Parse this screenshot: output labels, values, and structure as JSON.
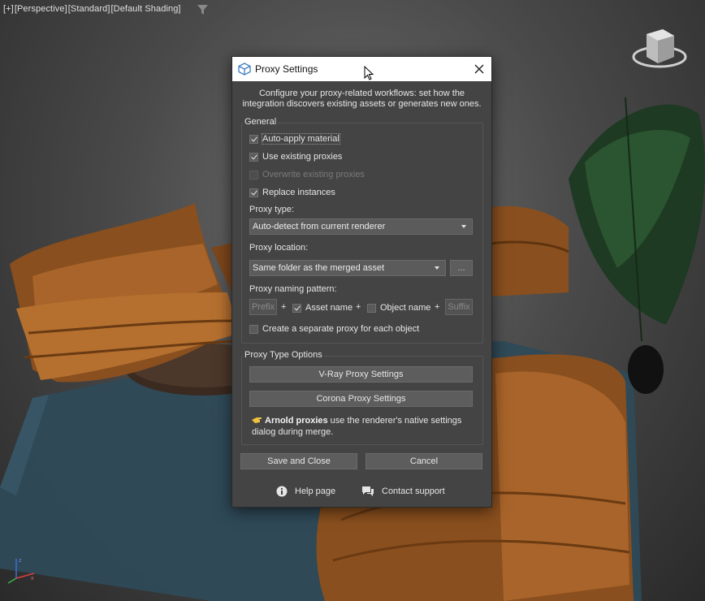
{
  "viewport": {
    "labels": [
      "[+]",
      "[Perspective]",
      "[Standard]",
      "[Default Shading]"
    ]
  },
  "dialog": {
    "title": "Proxy Settings",
    "description_line1": "Configure your proxy-related workflows: set how the",
    "description_line2": "integration discovers existing assets or generates new ones.",
    "general": {
      "title": "General",
      "auto_apply": {
        "label": "Auto-apply material",
        "checked": true
      },
      "use_existing": {
        "label": "Use existing proxies",
        "checked": true
      },
      "overwrite": {
        "label": "Overwrite existing proxies",
        "checked": false,
        "disabled": true
      },
      "replace": {
        "label": "Replace instances",
        "checked": true
      },
      "proxy_type_label": "Proxy type:",
      "proxy_type_value": "Auto-detect from current renderer",
      "proxy_location_label": "Proxy location:",
      "proxy_location_value": "Same folder as the merged asset",
      "browse_label": "...",
      "naming_label": "Proxy naming pattern:",
      "prefix_placeholder": "Prefix",
      "plus": "+",
      "asset_name": {
        "label": "Asset name",
        "checked": true
      },
      "object_name": {
        "label": "Object name",
        "checked": false
      },
      "suffix_placeholder": "Suffix",
      "separate_proxy": {
        "label": "Create a separate proxy for each object",
        "checked": false
      }
    },
    "type_options": {
      "title": "Proxy Type Options",
      "vray_button": "V-Ray Proxy Settings",
      "corona_button": "Corona Proxy Settings",
      "arnold_bold": "Arnold proxies",
      "arnold_text": " use the renderer's native settings dialog during merge."
    },
    "save_button": "Save and Close",
    "cancel_button": "Cancel",
    "help_label": "Help page",
    "contact_label": "Contact support"
  }
}
